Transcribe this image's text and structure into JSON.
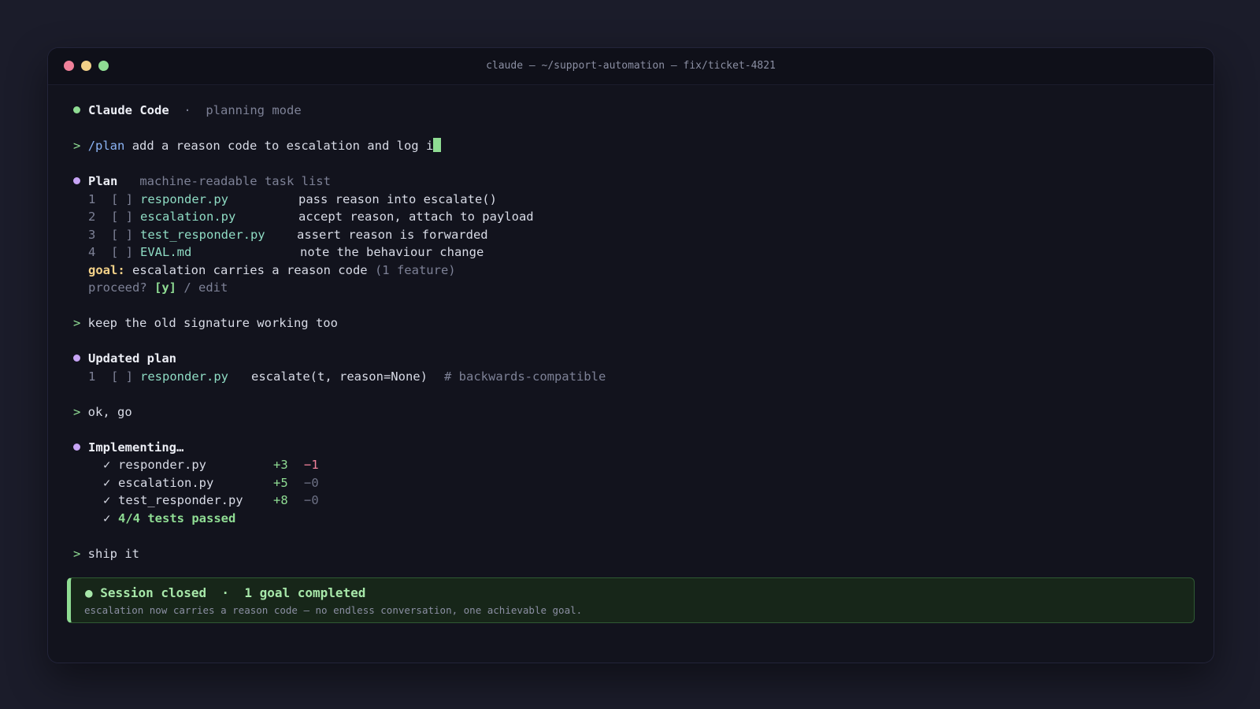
{
  "window": {
    "title": "claude — ~/support-automation — fix/ticket-4821"
  },
  "header": {
    "app": "Claude Code",
    "separator": "·",
    "mode": "planning mode"
  },
  "prompt1": {
    "symbol": ">",
    "command": "/plan",
    "text": " add a reason code to escalation and log i"
  },
  "plan": {
    "title": "Plan",
    "subtitle": "machine-readable task list",
    "tasks": [
      {
        "num": "1",
        "box": "[ ]",
        "file": "responder.py",
        "desc": "pass reason into escalate()"
      },
      {
        "num": "2",
        "box": "[ ]",
        "file": "escalation.py",
        "desc": "accept reason, attach to payload"
      },
      {
        "num": "3",
        "box": "[ ]",
        "file": "test_responder.py",
        "desc": "assert reason is forwarded"
      },
      {
        "num": "4",
        "box": "[ ]",
        "file": "EVAL.md",
        "desc": "note the behaviour change"
      }
    ],
    "goal_label": "goal:",
    "goal_text": " escalation carries a reason code ",
    "goal_note": "(1 feature)",
    "proceed_label": "proceed? ",
    "proceed_yes": "[y]",
    "proceed_rest": " / edit"
  },
  "prompt2": {
    "symbol": ">",
    "text": " keep the old signature working too"
  },
  "updated_plan": {
    "title": "Updated plan",
    "task": {
      "num": "1",
      "box": "[ ]",
      "file": "responder.py",
      "code": "escalate(t, reason=None)",
      "comment": "# backwards-compatible"
    }
  },
  "prompt3": {
    "symbol": ">",
    "text": " ok, go"
  },
  "implementing": {
    "title": "Implementing…",
    "files": [
      {
        "check": "✓",
        "name": "responder.py",
        "added": "+3",
        "removed": "−1"
      },
      {
        "check": "✓",
        "name": "escalation.py",
        "added": "+5",
        "removed": "−0"
      },
      {
        "check": "✓",
        "name": "test_responder.py",
        "added": "+8",
        "removed": "−0"
      }
    ],
    "tests_check": "✓",
    "tests": "4/4 tests passed"
  },
  "prompt4": {
    "symbol": ">",
    "text": " ship it"
  },
  "banner": {
    "bullet": "●",
    "title": "Session closed",
    "separator": "·",
    "result": "1 goal completed",
    "subtitle": "escalation now carries a reason code — no endless conversation, one achievable goal."
  },
  "colors": {
    "accent_green": "#8fdc93",
    "accent_purple": "#c7a4f5",
    "command_blue": "#8cb4f5",
    "file_teal": "#8fdcc4",
    "goal_yellow": "#f3d188",
    "minus_pink": "#f0819a"
  }
}
